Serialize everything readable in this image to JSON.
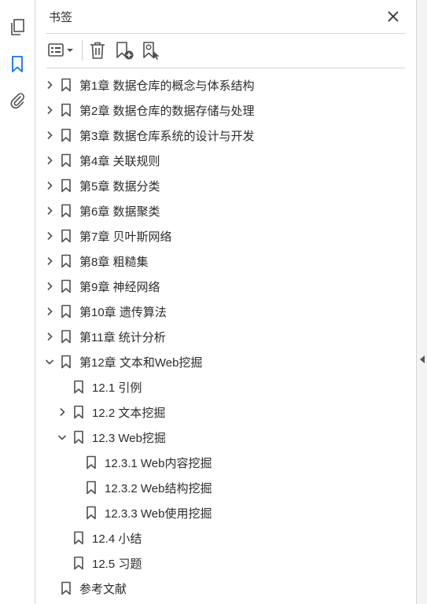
{
  "panel": {
    "title": "书签"
  },
  "colors": {
    "accent": "#1473e6",
    "icon": "#505050",
    "text": "#2c2c2c"
  },
  "rail_icons": [
    "pages-icon",
    "bookmark-icon",
    "attachment-icon"
  ],
  "toolbar_icons": [
    "options-menu-icon",
    "delete-icon",
    "new-bookmark-icon",
    "new-bookmark-from-structure-icon"
  ],
  "bookmarks": [
    {
      "label": "第1章 数据仓库的概念与体系结构",
      "level": 0,
      "state": "collapsed"
    },
    {
      "label": "第2章 数据仓库的数据存储与处理",
      "level": 0,
      "state": "collapsed"
    },
    {
      "label": "第3章 数据仓库系统的设计与开发",
      "level": 0,
      "state": "collapsed"
    },
    {
      "label": "第4章 关联规则",
      "level": 0,
      "state": "collapsed"
    },
    {
      "label": "第5章 数据分类",
      "level": 0,
      "state": "collapsed"
    },
    {
      "label": "第6章 数据聚类",
      "level": 0,
      "state": "collapsed"
    },
    {
      "label": "第7章 贝叶斯网络",
      "level": 0,
      "state": "collapsed"
    },
    {
      "label": "第8章 粗糙集",
      "level": 0,
      "state": "collapsed"
    },
    {
      "label": "第9章 神经网络",
      "level": 0,
      "state": "collapsed"
    },
    {
      "label": "第10章 遗传算法",
      "level": 0,
      "state": "collapsed"
    },
    {
      "label": "第11章 统计分析",
      "level": 0,
      "state": "collapsed"
    },
    {
      "label": "第12章 文本和Web挖掘",
      "level": 0,
      "state": "expanded"
    },
    {
      "label": "12.1 引例",
      "level": 1,
      "state": "leaf"
    },
    {
      "label": "12.2 文本挖掘",
      "level": 1,
      "state": "collapsed"
    },
    {
      "label": "12.3 Web挖掘",
      "level": 1,
      "state": "expanded"
    },
    {
      "label": "12.3.1 Web内容挖掘",
      "level": 2,
      "state": "leaf"
    },
    {
      "label": "12.3.2 Web结构挖掘",
      "level": 2,
      "state": "leaf"
    },
    {
      "label": "12.3.3 Web使用挖掘",
      "level": 2,
      "state": "leaf"
    },
    {
      "label": "12.4 小结",
      "level": 1,
      "state": "leaf"
    },
    {
      "label": "12.5 习题",
      "level": 1,
      "state": "leaf"
    },
    {
      "label": "参考文献",
      "level": 0,
      "state": "leaf"
    }
  ]
}
